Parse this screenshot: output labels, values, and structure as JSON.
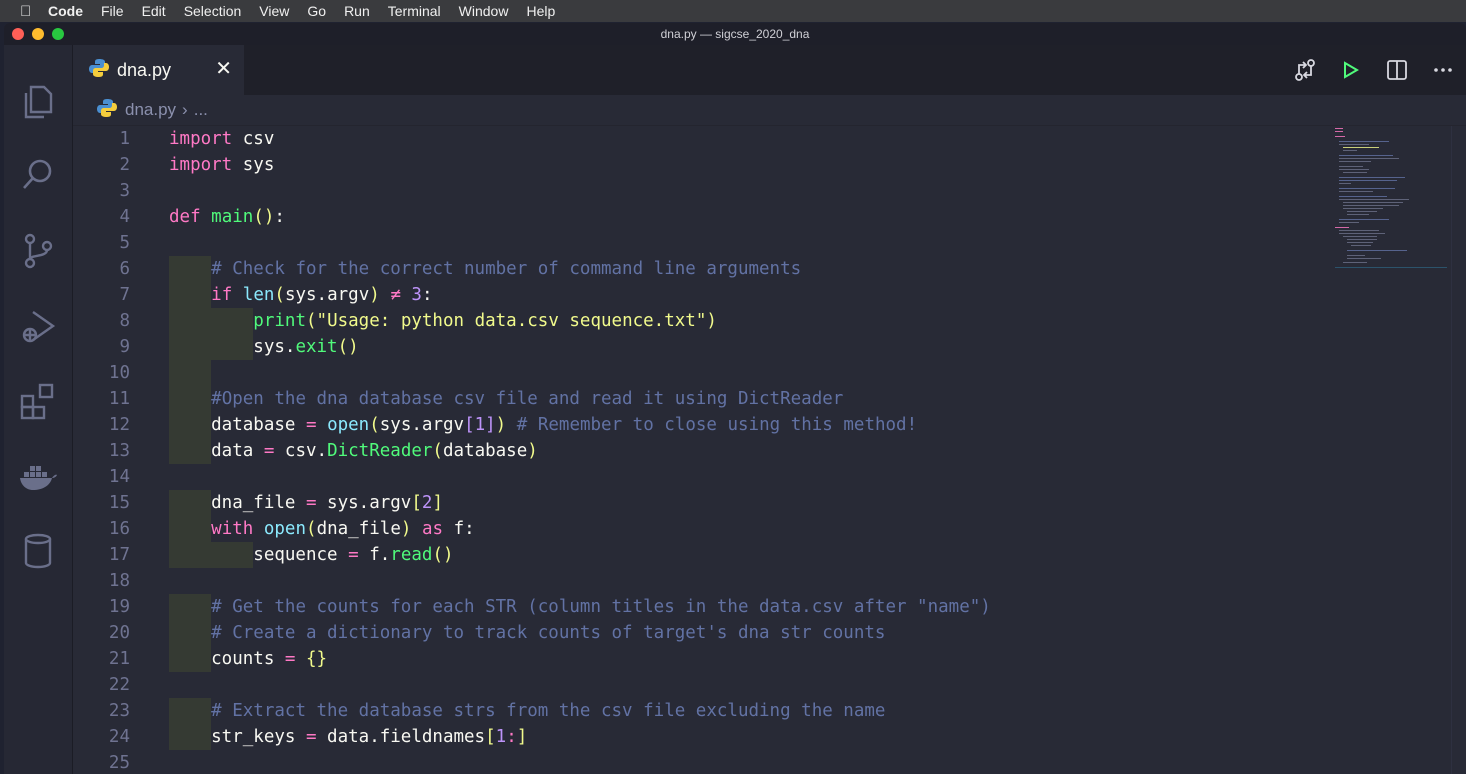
{
  "menubar": {
    "app": "Code",
    "items": [
      "File",
      "Edit",
      "Selection",
      "View",
      "Go",
      "Run",
      "Terminal",
      "Window",
      "Help"
    ]
  },
  "window": {
    "title": "dna.py — sigcse_2020_dna"
  },
  "tab": {
    "name": "dna.py",
    "close": "✕"
  },
  "breadcrumb": {
    "file": "dna.py",
    "sep": "›",
    "rest": "..."
  },
  "colors": {
    "accent_keyword": "#ff79c6",
    "function": "#50fa7b",
    "builtin": "#8be9fd",
    "comment": "#6272a4",
    "string": "#f1fa8c",
    "number": "#bd93f9",
    "background": "#282a36"
  },
  "icons": {
    "activity": [
      "explorer-icon",
      "search-icon",
      "source-control-icon",
      "run-debug-icon",
      "extensions-icon",
      "docker-icon",
      "database-icon"
    ],
    "actions": [
      "compare-changes-icon",
      "run-icon",
      "split-editor-icon",
      "more-actions-icon"
    ]
  },
  "code": {
    "line_numbers": [
      "1",
      "2",
      "3",
      "4",
      "5",
      "6",
      "7",
      "8",
      "9",
      "10",
      "11",
      "12",
      "13",
      "14",
      "15",
      "16",
      "17",
      "18",
      "19",
      "20",
      "21",
      "22",
      "23",
      "24",
      "25"
    ]
  }
}
